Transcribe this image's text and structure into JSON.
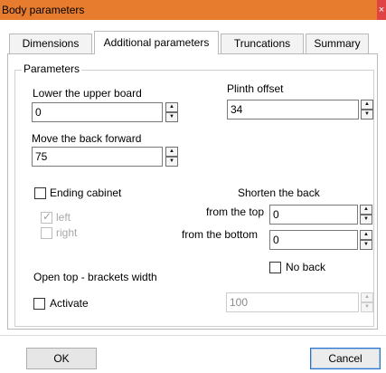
{
  "window": {
    "title": "Body parameters",
    "close_glyph": "×"
  },
  "tabs": [
    {
      "label": "Dimensions"
    },
    {
      "label": "Additional parameters",
      "active": true
    },
    {
      "label": "Truncations"
    },
    {
      "label": "Summary"
    }
  ],
  "group": {
    "legend": "Parameters"
  },
  "lower_board": {
    "label": "Lower the upper board",
    "value": "0"
  },
  "plinth": {
    "label": "Plinth offset",
    "value": "34"
  },
  "move_back": {
    "label": "Move the back forward",
    "value": "75"
  },
  "ending": {
    "label": "Ending cabinet",
    "checked": false,
    "left": {
      "label": "left",
      "checked": true,
      "disabled": true
    },
    "right": {
      "label": "right",
      "checked": false,
      "disabled": true
    }
  },
  "shorten": {
    "title": "Shorten the back",
    "top": {
      "label": "from the top",
      "value": "0"
    },
    "bottom": {
      "label": "from the bottom",
      "value": "0"
    },
    "no_back": {
      "label": "No back",
      "checked": false
    }
  },
  "open_top": {
    "label": "Open top - brackets width",
    "activate": {
      "label": "Activate",
      "checked": false
    },
    "value": "100"
  },
  "buttons": {
    "ok": "OK",
    "cancel": "Cancel"
  },
  "icons": {
    "spin_up": "▲",
    "spin_down": "▼",
    "check": "✓"
  },
  "colors": {
    "titlebar": "#e87c2e",
    "close": "#e04343",
    "default_button_border": "#2a73c7"
  }
}
